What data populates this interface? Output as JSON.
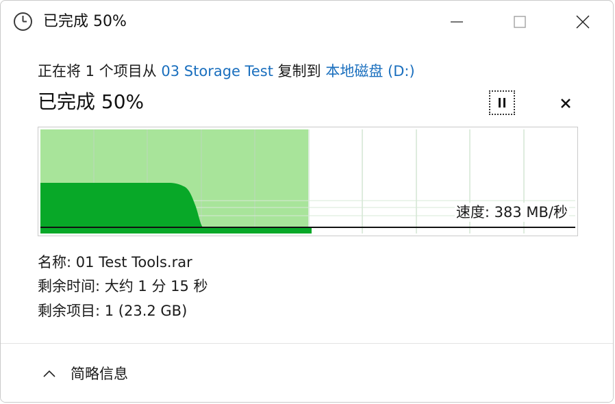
{
  "window": {
    "title": "已完成 50%",
    "icon": "clock-icon"
  },
  "copy": {
    "prefix": "正在将 1 个项目从 ",
    "source": "03 Storage Test",
    "middle": " 复制到 ",
    "destination": "本地磁盘 (D:)"
  },
  "progress": {
    "text": "已完成 50%",
    "fraction": 0.5
  },
  "graph": {
    "speed_label": "速度: 383 MB/秒",
    "fill_color": "#a8e49a",
    "speed_color": "#08a828",
    "line_color": "#111111"
  },
  "details": {
    "name": "名称: 01 Test Tools.rar",
    "time_remaining": "剩余时间: 大约 1 分 15 秒",
    "items_remaining": "剩余项目: 1 (23.2 GB)"
  },
  "footer": {
    "less_details": "简略信息"
  }
}
